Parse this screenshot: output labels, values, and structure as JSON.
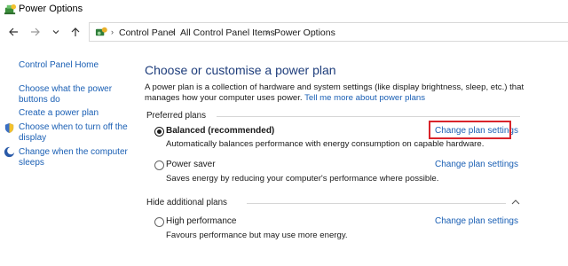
{
  "window": {
    "title": "Power Options"
  },
  "breadcrumb": [
    "Control Panel",
    "All Control Panel Items",
    "Power Options"
  ],
  "sidebar": {
    "home": "Control Panel Home",
    "links": [
      {
        "label_line1": "Choose what the power",
        "label_line2": "buttons do"
      },
      {
        "label_line1": "Create a power plan"
      },
      {
        "label_line1": "Choose when to turn off the",
        "label_line2": "display"
      },
      {
        "label_line1": "Change when the computer",
        "label_line2": "sleeps"
      }
    ]
  },
  "main": {
    "title": "Choose or customise a power plan",
    "description": "A power plan is a collection of hardware and system settings (like display brightness, sleep, etc.) that manages how your computer uses power.",
    "description_link": "Tell me more about power plans",
    "preferred_label": "Preferred plans",
    "hide_label": "Hide additional plans",
    "change_label": "Change plan settings",
    "plans": [
      {
        "name": "Balanced (recommended)",
        "desc": "Automatically balances performance with energy consumption on capable hardware.",
        "selected": true
      },
      {
        "name": "Power saver",
        "desc": "Saves energy by reducing your computer's performance where possible.",
        "selected": false
      },
      {
        "name": "High performance",
        "desc": "Favours performance but may use more energy.",
        "selected": false
      }
    ]
  },
  "colors": {
    "link": "#1a5fb4",
    "title": "#1e3d7b",
    "highlight": "#d9242b"
  },
  "icons": {
    "app": "power-options-icon",
    "back": "arrow-left-icon",
    "forward": "arrow-right-icon",
    "recent": "chevron-down-icon",
    "up": "arrow-up-icon",
    "control_panel": "control-panel-icon",
    "shield": "shield-icon",
    "moon": "moon-icon",
    "collapse": "chevron-up-icon"
  }
}
